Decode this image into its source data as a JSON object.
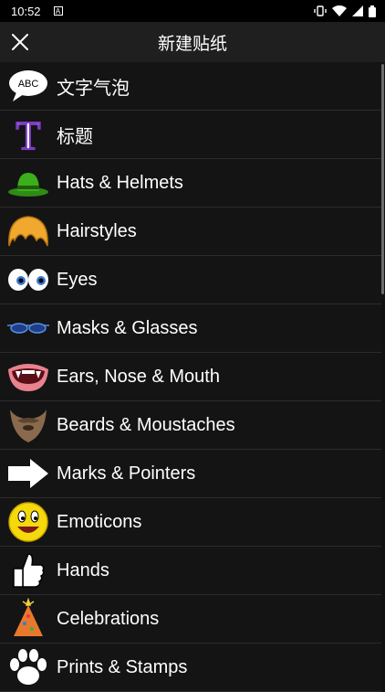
{
  "status": {
    "time": "10:52",
    "notif": "A"
  },
  "toolbar": {
    "title": "新建贴纸"
  },
  "items": [
    {
      "label": "文字气泡",
      "icon": "speech-bubble-icon",
      "badge": "ABC"
    },
    {
      "label": "标题",
      "icon": "title-letter-icon",
      "badge": "T"
    },
    {
      "label": "Hats & Helmets",
      "icon": "green-hat-icon"
    },
    {
      "label": "Hairstyles",
      "icon": "hair-icon"
    },
    {
      "label": "Eyes",
      "icon": "eyes-icon"
    },
    {
      "label": "Masks & Glasses",
      "icon": "glasses-icon"
    },
    {
      "label": "Ears, Nose & Mouth",
      "icon": "mouth-icon"
    },
    {
      "label": "Beards & Moustaches",
      "icon": "beard-icon"
    },
    {
      "label": "Marks & Pointers",
      "icon": "arrow-icon"
    },
    {
      "label": "Emoticons",
      "icon": "emoticon-icon"
    },
    {
      "label": "Hands",
      "icon": "thumbs-up-icon"
    },
    {
      "label": "Celebrations",
      "icon": "party-hat-icon"
    },
    {
      "label": "Prints & Stamps",
      "icon": "paw-print-icon"
    }
  ]
}
